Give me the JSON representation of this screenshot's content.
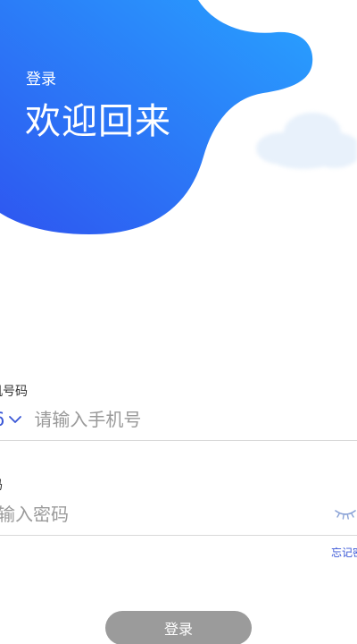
{
  "header": {
    "subtitle": "登录",
    "title": "欢迎回来"
  },
  "phone": {
    "label": "机号码",
    "country_code": "6",
    "placeholder": "请输入手机号"
  },
  "password": {
    "label": "码",
    "placeholder": "输入密码",
    "forgot_label": "忘记密"
  },
  "login_button": {
    "label": "登录"
  },
  "icons": {
    "country_dropdown": "chevron-down-icon",
    "password_visibility": "eye-closed-icon"
  },
  "colors": {
    "hero_gradient_start": "#2e56f0",
    "hero_gradient_end": "#28a2ff",
    "accent": "#3a57d6",
    "button_disabled": "#9b9b9b",
    "placeholder": "#9a9a9a"
  }
}
